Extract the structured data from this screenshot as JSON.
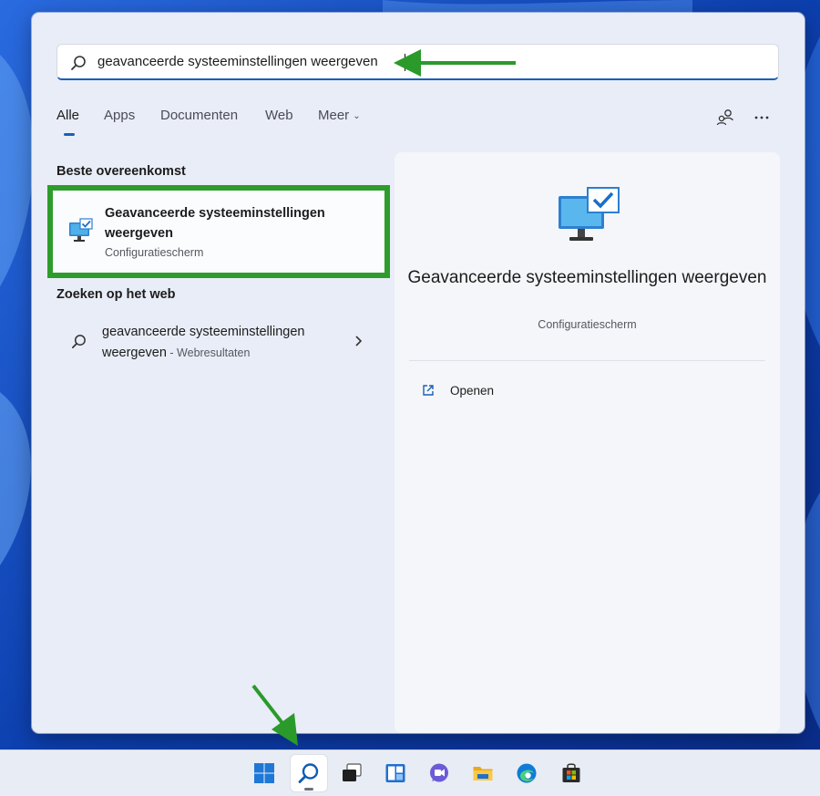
{
  "colors": {
    "accent": "#1a5fb4",
    "highlight": "#2e9c2c",
    "panel_bg": "#e9edf7",
    "wallpaper": "#0b3fa8"
  },
  "search": {
    "icon": "search-icon",
    "value": "geavanceerde systeeminstellingen weergeven"
  },
  "tabs": [
    {
      "label": "Alle",
      "active": true
    },
    {
      "label": "Apps"
    },
    {
      "label": "Documenten"
    },
    {
      "label": "Web"
    },
    {
      "label": "Meer",
      "icon": "chevron-down-icon"
    }
  ],
  "top_icons": [
    "share-people-icon",
    "more-options-icon"
  ],
  "best_match": {
    "heading": "Beste overeenkomst",
    "title": "Geavanceerde systeeminstellingen weergeven",
    "subtitle": "Configuratiescherm",
    "icon": "monitor-check-icon"
  },
  "web_search": {
    "heading": "Zoeken op het web",
    "line1": "geavanceerde systeeminstellingen",
    "line2": "weergeven",
    "suffix": " - Webresultaten",
    "icon": "search-icon"
  },
  "detail": {
    "title": "Geavanceerde systeeminstellingen weergeven",
    "subtitle": "Configuratiescherm",
    "icon": "monitor-check-icon",
    "actions": [
      {
        "label": "Openen",
        "icon": "open-external-icon"
      }
    ]
  },
  "taskbar": {
    "items": [
      "windows-start-icon",
      "search-icon",
      "task-view-icon",
      "widgets-icon",
      "teams-chat-icon",
      "file-explorer-icon",
      "edge-icon",
      "store-icon"
    ],
    "active": "search-icon"
  }
}
